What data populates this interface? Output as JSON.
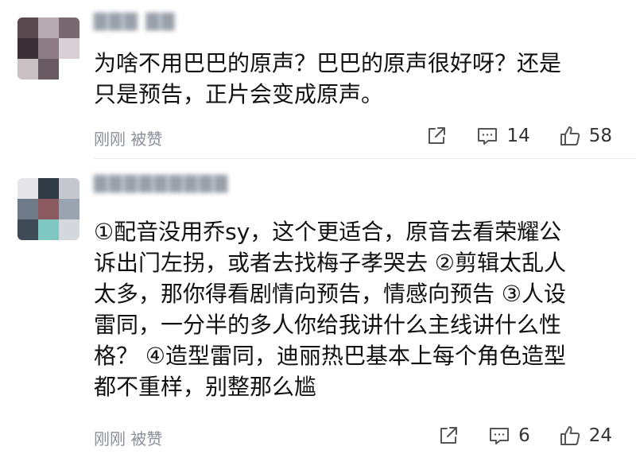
{
  "comments": [
    {
      "username": "▇▇▇ ▇▇",
      "lines": [
        "为啥不用巴巴的原声？巴巴的原声很好呀？还是",
        "只是预告，正片会变成原声。"
      ],
      "meta": "刚刚 被赞",
      "replies": "14",
      "likes": "58"
    },
    {
      "username": "▇▇▇▇▇▇▇▇▇",
      "lines": [
        "①配音没用乔sy，这个更适合，原音去看荣耀公",
        "诉出门左拐，或者去找梅子孝哭去 ②剪辑太乱人",
        "太多，那你得看剧情向预告，情感向预告 ③人设",
        "雷同，一分半的多人你给我讲什么主线讲什么性",
        "格？ ④造型雷同，迪丽热巴基本上每个角色造型",
        "都不重样，别整那么尴"
      ],
      "meta": "刚刚 被赞",
      "replies": "6",
      "likes": "24"
    }
  ],
  "icons": {
    "share": "share-icon",
    "comment": "comment-icon",
    "like": "thumbs-up-icon"
  }
}
